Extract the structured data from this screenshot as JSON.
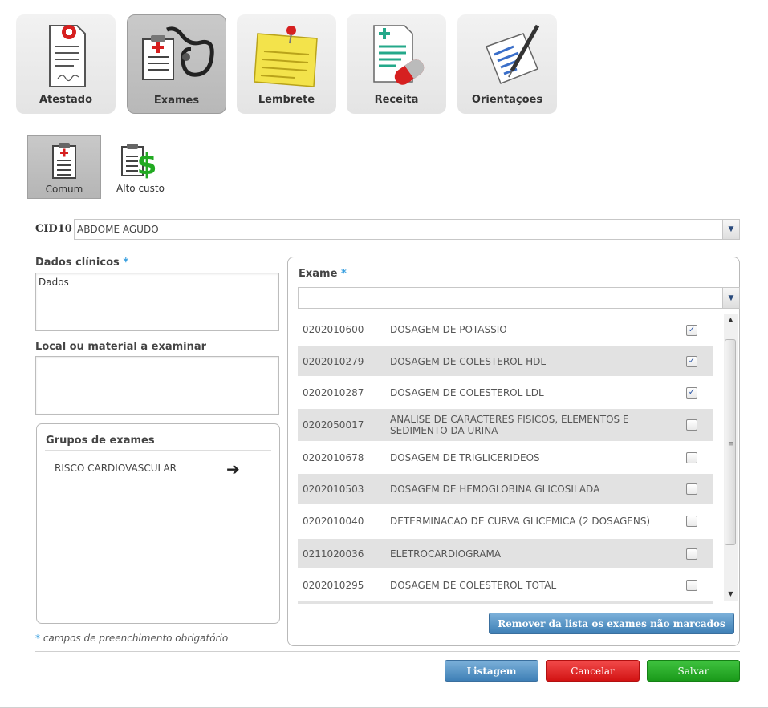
{
  "tabs": [
    {
      "label": "Atestado",
      "icon": "medical-certificate-icon",
      "active": false
    },
    {
      "label": "Exames",
      "icon": "stethoscope-clipboard-icon",
      "active": true
    },
    {
      "label": "Lembrete",
      "icon": "sticky-note-pin-icon",
      "active": false
    },
    {
      "label": "Receita",
      "icon": "prescription-pill-icon",
      "active": false
    },
    {
      "label": "Orientações",
      "icon": "document-pen-icon",
      "active": false
    }
  ],
  "subtabs": [
    {
      "label": "Comum",
      "icon": "clipboard-cross-icon",
      "active": true
    },
    {
      "label": "Alto custo",
      "icon": "clipboard-dollar-icon",
      "active": false
    }
  ],
  "cid": {
    "label": "CID10",
    "value": "ABDOME AGUDO"
  },
  "dados_clinicos": {
    "label": "Dados clínicos",
    "required_mark": "*",
    "value": "Dados"
  },
  "local_material": {
    "label": "Local ou material a examinar",
    "value": ""
  },
  "grupos": {
    "title": "Grupos de exames",
    "items": [
      {
        "label": "RISCO CARDIOVASCULAR"
      }
    ]
  },
  "exame": {
    "label": "Exame",
    "required_mark": "*",
    "value": ""
  },
  "exams": [
    {
      "code": "0202010600",
      "name": "DOSAGEM DE POTASSIO",
      "checked": true
    },
    {
      "code": "0202010279",
      "name": "DOSAGEM DE COLESTEROL HDL",
      "checked": true
    },
    {
      "code": "0202010287",
      "name": "DOSAGEM DE COLESTEROL LDL",
      "checked": true
    },
    {
      "code": "0202050017",
      "name": "ANALISE DE CARACTERES FISICOS, ELEMENTOS E SEDIMENTO DA URINA",
      "checked": false
    },
    {
      "code": "0202010678",
      "name": "DOSAGEM DE TRIGLICERIDEOS",
      "checked": false
    },
    {
      "code": "0202010503",
      "name": "DOSAGEM DE HEMOGLOBINA GLICOSILADA",
      "checked": false
    },
    {
      "code": "0202010040",
      "name": "DETERMINACAO DE CURVA GLICEMICA (2 DOSAGENS)",
      "checked": false
    },
    {
      "code": "0211020036",
      "name": "ELETROCARDIOGRAMA",
      "checked": false
    },
    {
      "code": "0202010295",
      "name": "DOSAGEM DE COLESTEROL TOTAL",
      "checked": false
    }
  ],
  "buttons": {
    "remove_unchecked": "Remover da lista os exames não marcados",
    "listagem": "Listagem",
    "cancelar": "Cancelar",
    "salvar": "Salvar"
  },
  "required_note": {
    "mark": "*",
    "text": "campos de preenchimento obrigatório"
  },
  "colors": {
    "required_star": "#3aa0e0",
    "cancel": "#e02020",
    "save": "#22a822",
    "primary": "#4a8ac0"
  }
}
